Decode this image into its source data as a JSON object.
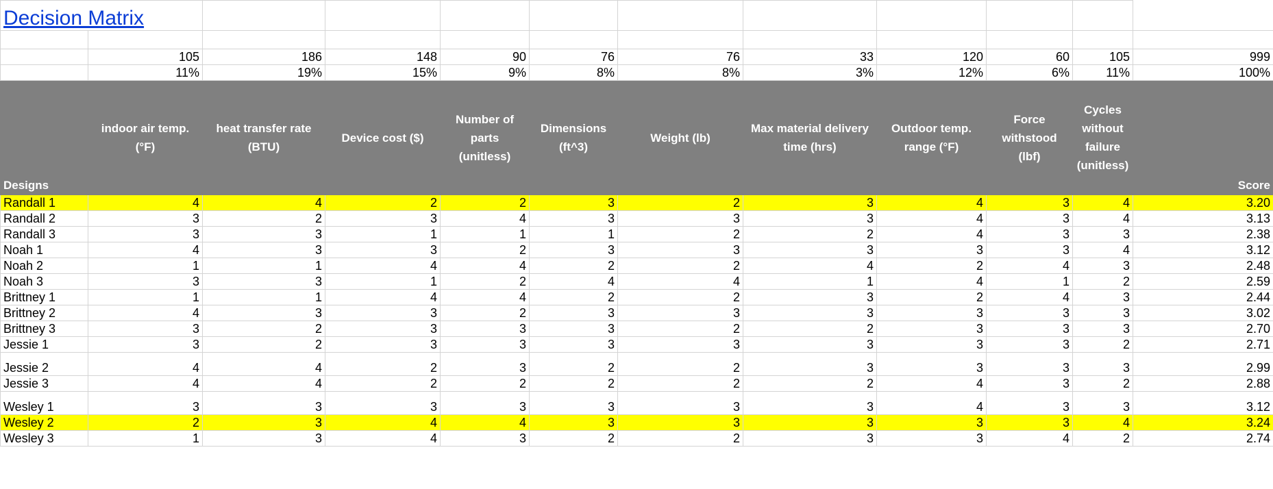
{
  "title": "Decision Matrix",
  "weights": {
    "points": [
      "105",
      "186",
      "148",
      "90",
      "76",
      "76",
      "33",
      "120",
      "60",
      "105",
      "999"
    ],
    "percents": [
      "11%",
      "19%",
      "15%",
      "9%",
      "8%",
      "8%",
      "3%",
      "12%",
      "6%",
      "11%",
      "100%"
    ]
  },
  "header": {
    "designs": "Designs",
    "criteria": [
      "indoor air temp. (°F)",
      "heat transfer rate (BTU)",
      "Device cost ($)",
      "Number of parts (unitless)",
      "Dimensions (ft^3)",
      "Weight (lb)",
      "Max material delivery time (hrs)",
      "Outdoor temp. range (°F)",
      "Force withstood (lbf)",
      "Cycles without failure (unitless)"
    ],
    "score": "Score"
  },
  "highlight_color": "#ffff00",
  "header_color": "#808080",
  "rows": [
    {
      "name": "Randall 1",
      "values": [
        "4",
        "4",
        "2",
        "2",
        "3",
        "2",
        "3",
        "4",
        "3",
        "4"
      ],
      "score": "3.20",
      "highlight": true
    },
    {
      "name": "Randall 2",
      "values": [
        "3",
        "2",
        "3",
        "4",
        "3",
        "3",
        "3",
        "4",
        "3",
        "4"
      ],
      "score": "3.13",
      "highlight": false
    },
    {
      "name": "Randall 3",
      "values": [
        "3",
        "3",
        "1",
        "1",
        "1",
        "2",
        "2",
        "4",
        "3",
        "3"
      ],
      "score": "2.38",
      "highlight": false
    },
    {
      "name": "Noah 1",
      "values": [
        "4",
        "3",
        "3",
        "2",
        "3",
        "3",
        "3",
        "3",
        "3",
        "4"
      ],
      "score": "3.12",
      "highlight": false
    },
    {
      "name": "Noah 2",
      "values": [
        "1",
        "1",
        "4",
        "4",
        "2",
        "2",
        "4",
        "2",
        "4",
        "3"
      ],
      "score": "2.48",
      "highlight": false
    },
    {
      "name": "Noah 3",
      "values": [
        "3",
        "3",
        "1",
        "2",
        "4",
        "4",
        "1",
        "4",
        "1",
        "2"
      ],
      "score": "2.59",
      "highlight": false
    },
    {
      "name": "Brittney 1",
      "values": [
        "1",
        "1",
        "4",
        "4",
        "2",
        "2",
        "3",
        "2",
        "4",
        "3"
      ],
      "score": "2.44",
      "highlight": false
    },
    {
      "name": "Brittney 2",
      "values": [
        "4",
        "3",
        "3",
        "2",
        "3",
        "3",
        "3",
        "3",
        "3",
        "3"
      ],
      "score": "3.02",
      "highlight": false
    },
    {
      "name": "Brittney 3",
      "values": [
        "3",
        "2",
        "3",
        "3",
        "3",
        "2",
        "2",
        "3",
        "3",
        "3"
      ],
      "score": "2.70",
      "highlight": false
    },
    {
      "name": "Jessie 1",
      "values": [
        "3",
        "2",
        "3",
        "3",
        "3",
        "3",
        "3",
        "3",
        "3",
        "2"
      ],
      "score": "2.71",
      "highlight": false
    },
    {
      "name": "Jessie 2",
      "values": [
        "4",
        "4",
        "2",
        "3",
        "2",
        "2",
        "3",
        "3",
        "3",
        "3"
      ],
      "score": "2.99",
      "highlight": false
    },
    {
      "name": "Jessie 3",
      "values": [
        "4",
        "4",
        "2",
        "2",
        "2",
        "2",
        "2",
        "4",
        "3",
        "2"
      ],
      "score": "2.88",
      "highlight": false
    },
    {
      "name": "Wesley 1",
      "values": [
        "3",
        "3",
        "3",
        "3",
        "3",
        "3",
        "3",
        "4",
        "3",
        "3"
      ],
      "score": "3.12",
      "highlight": false
    },
    {
      "name": "Wesley 2",
      "values": [
        "2",
        "3",
        "4",
        "4",
        "3",
        "3",
        "3",
        "3",
        "3",
        "4"
      ],
      "score": "3.24",
      "highlight": true
    },
    {
      "name": "Wesley 3",
      "values": [
        "1",
        "3",
        "4",
        "3",
        "2",
        "2",
        "3",
        "3",
        "4",
        "2"
      ],
      "score": "2.74",
      "highlight": false
    }
  ]
}
